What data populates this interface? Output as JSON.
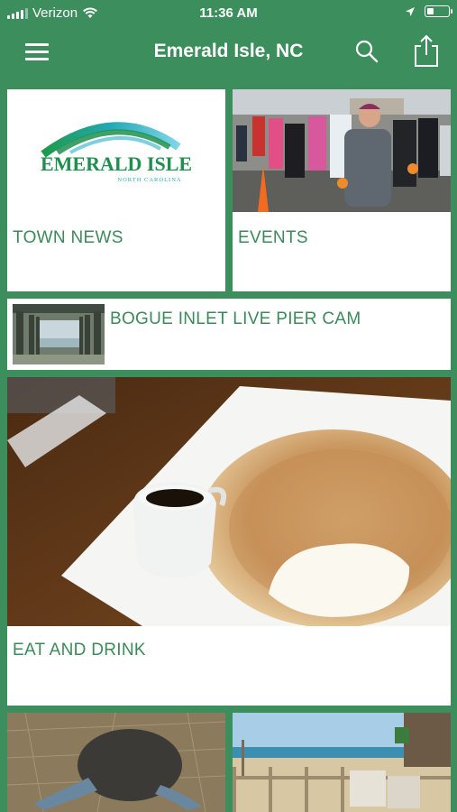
{
  "status_bar": {
    "carrier": "Verizon",
    "time": "11:36 AM"
  },
  "nav": {
    "title": "Emerald Isle, NC"
  },
  "logo": {
    "name": "EMERALD ISLE",
    "tagline": "NORTH CAROLINA"
  },
  "tiles": {
    "town_news": "TOWN NEWS",
    "events": "EVENTS",
    "pier_cam": "BOGUE INLET LIVE PIER CAM",
    "eat_drink": "EAT AND DRINK"
  },
  "colors": {
    "brand_green": "#3d8e5d",
    "label_green": "#3c8a5a"
  },
  "icons": [
    "menu-icon",
    "search-icon",
    "share-icon",
    "location-arrow-icon",
    "wifi-icon",
    "battery-icon"
  ]
}
